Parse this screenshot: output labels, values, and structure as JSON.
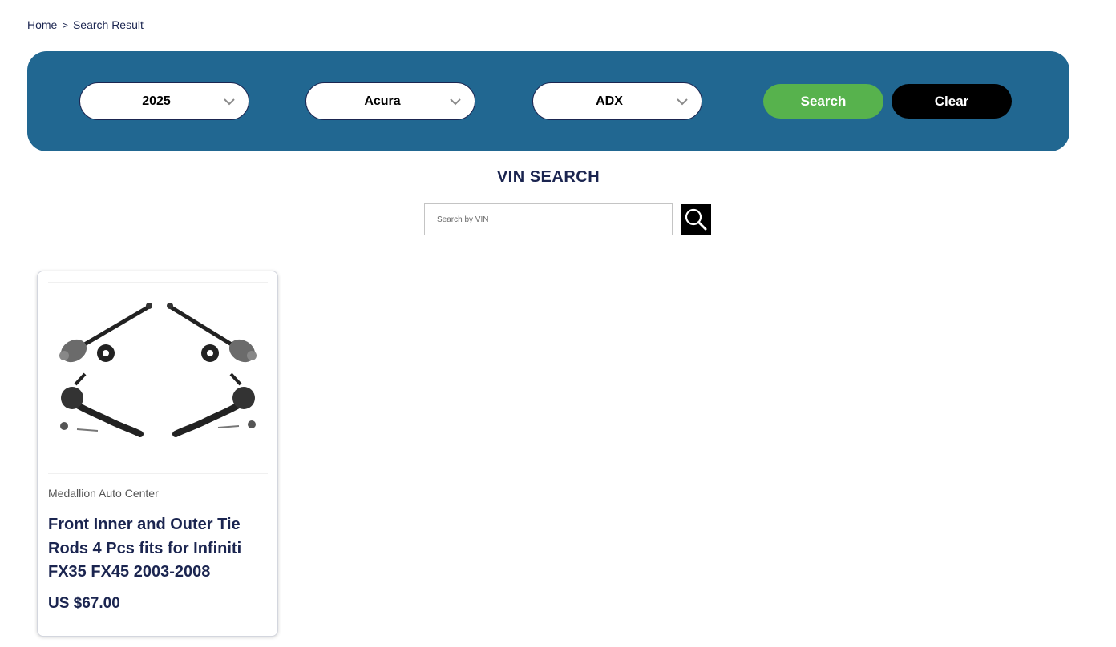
{
  "breadcrumb": {
    "home": "Home",
    "separator": ">",
    "current": "Search Result"
  },
  "filters": {
    "year": {
      "value": "2025"
    },
    "make": {
      "value": "Acura"
    },
    "model": {
      "value": "ADX"
    },
    "search_label": "Search",
    "clear_label": "Clear"
  },
  "vin": {
    "title": "VIN SEARCH",
    "placeholder": "Search by VIN"
  },
  "products": [
    {
      "vendor": "Medallion Auto Center",
      "title": "Front Inner and Outer Tie Rods 4 Pcs fits for Infiniti FX35 FX45 2003-2008",
      "price": "US $67.00"
    }
  ],
  "colors": {
    "filter_bg": "#216791",
    "search_btn": "#57b24d",
    "clear_btn": "#000000",
    "text_dark": "#1b2550"
  }
}
